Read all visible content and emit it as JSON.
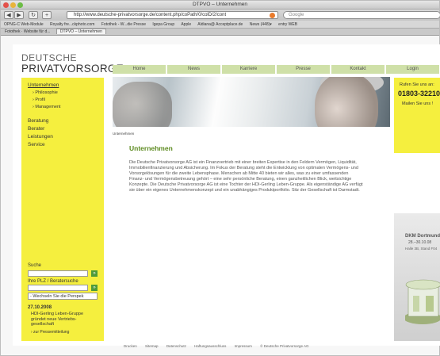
{
  "browser": {
    "window_title": "DTPVO – Unternehmen",
    "url": "http://www.deutsche-privatvorsorge.de/content.php/coPath/0/colD/2/cont",
    "search_placeholder": "Google",
    "bookmarks": [
      "OPNG-C Web-Module",
      "Royalty fre...ckphoto.com",
      "Fotothek - W...die Presse",
      "Igepa Group",
      "Apple",
      "Aldiana@ Acceptplace.de",
      "News (448)▾",
      "entry WEB"
    ],
    "tabs": [
      "Fotothek · Website für d...",
      "DTPVO – Unternehmen"
    ]
  },
  "site": {
    "logo_line1": "DEUTSCHE",
    "logo_line2": "PRIVATVORSORGE",
    "logo_mark": "AG",
    "nav": [
      "Home",
      "News",
      "Karriere",
      "Presse",
      "Kontakt",
      "Login"
    ]
  },
  "sidebar": {
    "main_active": "Unternehmen",
    "sub": [
      "› Philosophie",
      "› Profil",
      "› Management"
    ],
    "items": [
      "Beratung",
      "Berater",
      "Leistungen",
      "Service"
    ],
    "search_label": "Suche",
    "plz_label": "Ihre PLZ / Beratersuche",
    "go": "»",
    "select_value": "- Wechseln Sie die Perspek",
    "news_date": "27.10.2008",
    "news_text": "HDI-Gerling Leben-Gruppe gründet neue Vertriebs-gesellschaft",
    "news_link": "› zur Pressemitteilung"
  },
  "content": {
    "breadcrumb": "Unternehmen",
    "heading": "Unternehmen",
    "body": "Die Deutsche Privatvorsorge AG ist ein Finanzvertrieb mit einer breiten Expertise in den Feldern Vermögen, Liquidität, Immobilienfinanzierung und Absicherung. Im Fokus der Beratung steht die Entwicklung von optimalen Vermögens- und Vorsorgelösungen für die zweite Lebensphase. Menschen ab Mitte 40 bieten wir alles, was zu einer umfassenden Finanz- und Vermögensbetreuung gehört – eine sehr persönliche Beratung, einen ganzheitlichen Blick, weitsichtige Konzepte. Die Deutsche Privatvorsorge AG ist eine Tochter der HDI-Gerling Leben-Gruppe. Als eigenständige AG verfügt sie über ein eigenes Unternehmenskonzept und ein unabhängiges Produktportfolio. Sitz der Gesellschaft ist Darmstadt."
  },
  "right": {
    "call_label": "Rufen Sie uns an:",
    "phone": "01803-322102",
    "call_text": "Mailen Sie uns !",
    "promo_title": "DKM Dortmund",
    "promo_dates": "28.–30.10.08",
    "promo_hall": "Halle 3B, Stand F04"
  },
  "footer": [
    "Drucken",
    "Sitemap",
    "Datenschutz",
    "Haftungsausschluss",
    "Impressum",
    "© Deutsche Privatvorsorge AG"
  ]
}
